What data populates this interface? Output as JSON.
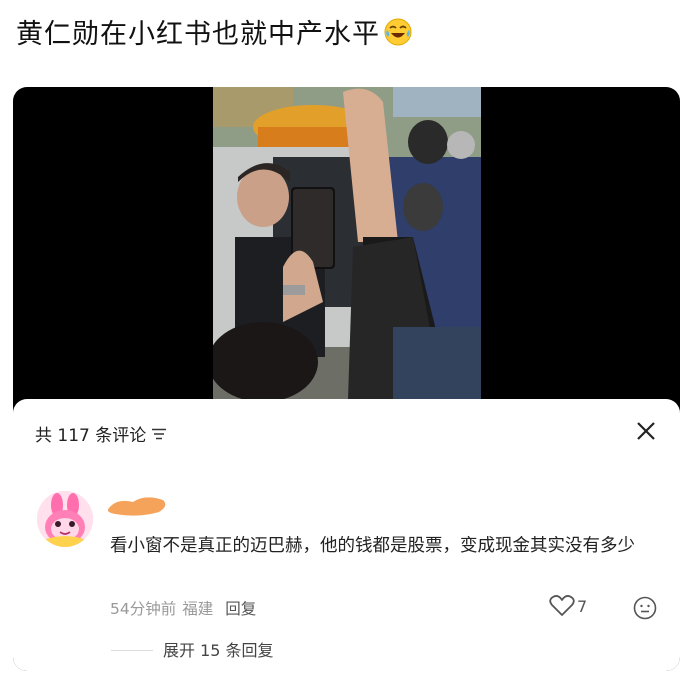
{
  "post": {
    "title": "黄仁勋在小红书也就中产水平",
    "title_emoji": "tears-of-joy-emoji"
  },
  "video": {
    "content": "crowd-photo"
  },
  "comments_panel": {
    "count_label": "共 117 条评论",
    "filter_icon": "filter-icon",
    "close_icon": "close-icon"
  },
  "comment": {
    "avatar": "cartoon-rabbit-avatar",
    "username_hidden": true,
    "text": "看小窗不是真正的迈巴赫，他的钱都是股票，变成现金其实没有多少",
    "time": "54分钟前",
    "location": "福建",
    "reply_label": "回复",
    "likes": "7",
    "expand_label": "展开 15 条回复"
  },
  "colors": {
    "card_bg": "#000000",
    "sheet_bg": "#ffffff",
    "meta_gray": "#999999",
    "username_mask": "#f5a25a"
  }
}
